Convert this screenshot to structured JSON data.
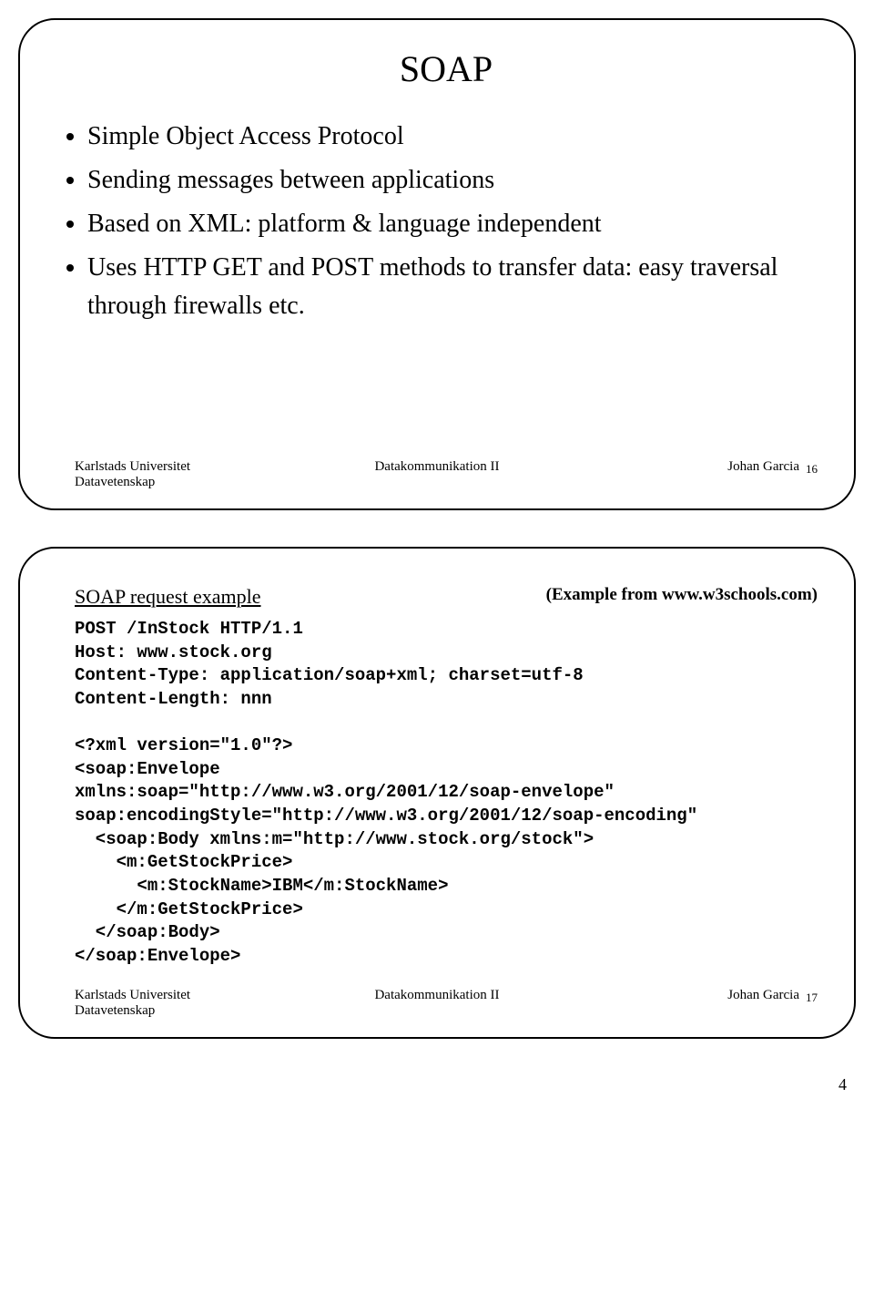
{
  "slide1": {
    "title": "SOAP",
    "bullets": [
      "Simple Object Access Protocol",
      "Sending messages between applications",
      "Based on XML: platform & language independent",
      "Uses HTTP GET and POST methods to transfer data: easy traversal through firewalls etc."
    ],
    "footer": {
      "uni": "Karlstads Universitet",
      "dept": "Datavetenskap",
      "course": "Datakommunikation II",
      "author": "Johan Garcia"
    },
    "number": "16"
  },
  "slide2": {
    "example_label": "SOAP request example",
    "example_source": "(Example from www.w3schools.com)",
    "code": "POST /InStock HTTP/1.1\nHost: www.stock.org\nContent-Type: application/soap+xml; charset=utf-8\nContent-Length: nnn\n\n<?xml version=\"1.0\"?>\n<soap:Envelope\nxmlns:soap=\"http://www.w3.org/2001/12/soap-envelope\"\nsoap:encodingStyle=\"http://www.w3.org/2001/12/soap-encoding\"\n  <soap:Body xmlns:m=\"http://www.stock.org/stock\">\n    <m:GetStockPrice>\n      <m:StockName>IBM</m:StockName>\n    </m:GetStockPrice>\n  </soap:Body>\n</soap:Envelope>",
    "footer": {
      "uni": "Karlstads Universitet",
      "dept": "Datavetenskap",
      "course": "Datakommunikation II",
      "author": "Johan Garcia"
    },
    "number": "17"
  },
  "page_number": "4"
}
